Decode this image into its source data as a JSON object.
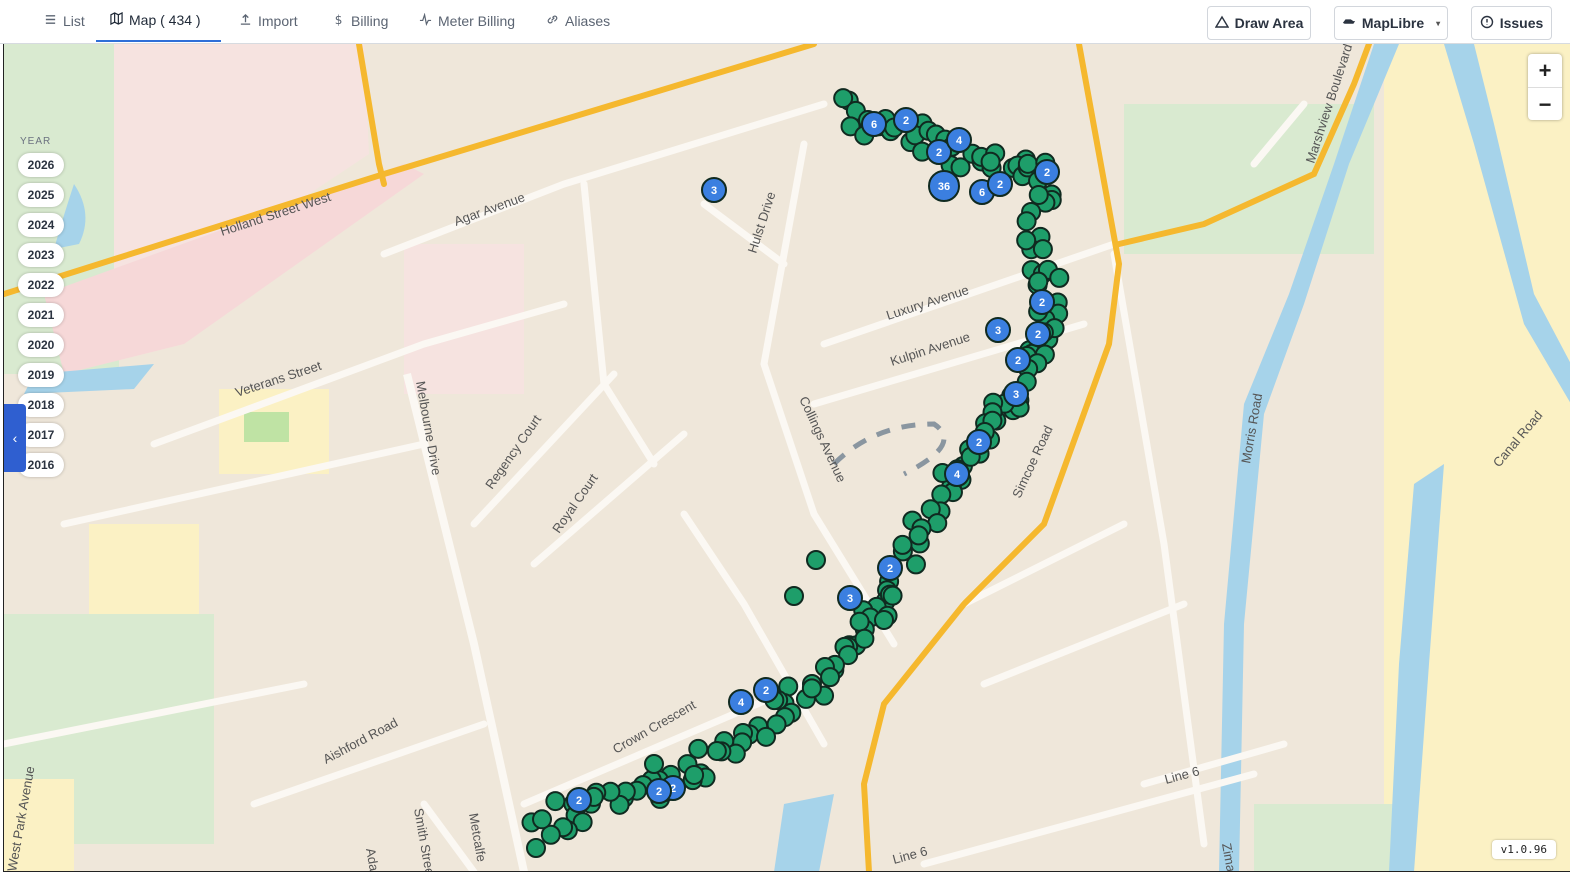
{
  "tabs": [
    {
      "label": "List",
      "icon": "list-icon",
      "active": false
    },
    {
      "label": "Map ( 434 )",
      "icon": "map-icon",
      "active": true
    },
    {
      "label": "Import",
      "icon": "upload-icon",
      "active": false
    },
    {
      "label": "Billing",
      "icon": "dollar-icon",
      "active": false
    },
    {
      "label": "Meter Billing",
      "icon": "activity-icon",
      "active": false
    },
    {
      "label": "Aliases",
      "icon": "link-icon",
      "active": false
    }
  ],
  "toolbar": {
    "draw_area": "Draw Area",
    "map_engine": "MapLibre",
    "issues": "Issues"
  },
  "year_filter": {
    "label": "YEAR",
    "years": [
      "2026",
      "2025",
      "2024",
      "2023",
      "2022",
      "2021",
      "2020",
      "2019",
      "2018",
      "2017",
      "2016"
    ]
  },
  "zoom": {
    "in": "+",
    "out": "−"
  },
  "version": "v1.0.96",
  "streets": [
    "Holland Street West",
    "Agar Avenue",
    "Hulst Drive",
    "Veterans Street",
    "Melbourne Drive",
    "Regency Court",
    "Royal Court",
    "Collings Avenue",
    "Luxury Avenue",
    "Kulpin Avenue",
    "Simcoe Road",
    "Morris Road",
    "Marshview Boulevard",
    "Canal Road",
    "Crown Crescent",
    "Aishford Road",
    "Smith Street",
    "Metcalfe",
    "Line 6",
    "West Park Avenue",
    "Ada",
    "Zima"
  ],
  "clusters": [
    "2",
    "6",
    "2",
    "4",
    "36",
    "6",
    "2",
    "2",
    "3",
    "3",
    "2",
    "2",
    "3",
    "2",
    "4",
    "2",
    "3",
    "2",
    "4",
    "2",
    "2",
    "2",
    "2"
  ],
  "colors": {
    "marker_green": "#1e9e6a",
    "cluster_blue": "#3b7fe0",
    "road_major": "#f5b82e",
    "water": "#a6d3ea",
    "accent": "#2f6fd8"
  }
}
